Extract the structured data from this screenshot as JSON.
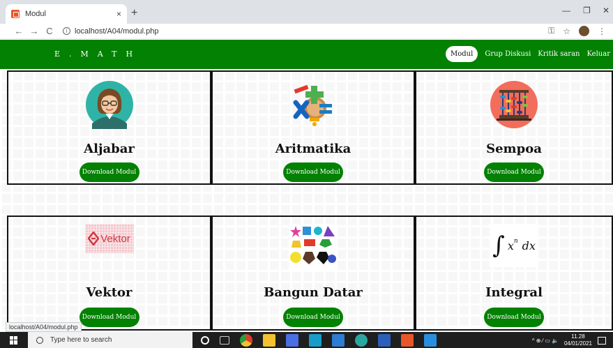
{
  "browser": {
    "tab_title": "Modul",
    "tab_close": "×",
    "new_tab": "+",
    "url": "localhost/A04/modul.php",
    "back": "←",
    "forward": "→",
    "reload": "C",
    "info": "i",
    "key_icon": "⚿",
    "star_icon": "☆",
    "menu_icon": "⋮",
    "minimize": "—",
    "maximize": "❐",
    "close": "✕"
  },
  "site": {
    "brand": "E.MATH",
    "nav": [
      {
        "label": "Modul",
        "active": true
      },
      {
        "label": "Grup Diskusi",
        "active": false
      },
      {
        "label": "Kritik saran",
        "active": false
      },
      {
        "label": "Keluar",
        "active": false
      }
    ]
  },
  "modules": [
    {
      "title": "Aljabar",
      "button": "Download Modul",
      "icon": "teacher-avatar-icon"
    },
    {
      "title": "Aritmatika",
      "button": "Download Modul",
      "icon": "math-symbols-icon"
    },
    {
      "title": "Sempoa",
      "button": "Download Modul",
      "icon": "abacus-icon"
    },
    {
      "title": "Vektor",
      "button": "Download Modul",
      "icon": "vektor-logo-icon",
      "image_text": "Vektor"
    },
    {
      "title": "Bangun Datar",
      "button": "Download Modul",
      "icon": "shapes-icon"
    },
    {
      "title": "Integral",
      "button": "Download Modul",
      "icon": "integral-icon",
      "formula_x": "x",
      "formula_n": "n",
      "formula_dx": "dx"
    }
  ],
  "status_url": "localhost/A04/modul.php",
  "taskbar": {
    "search_placeholder": "Type here to search",
    "time": "11.28",
    "date": "04/01/2021",
    "tray": "^ ⊕ ⁄ ▭ 🔈"
  },
  "colors": {
    "brand_green": "#028102",
    "tab_bar": "#dee1e6"
  }
}
